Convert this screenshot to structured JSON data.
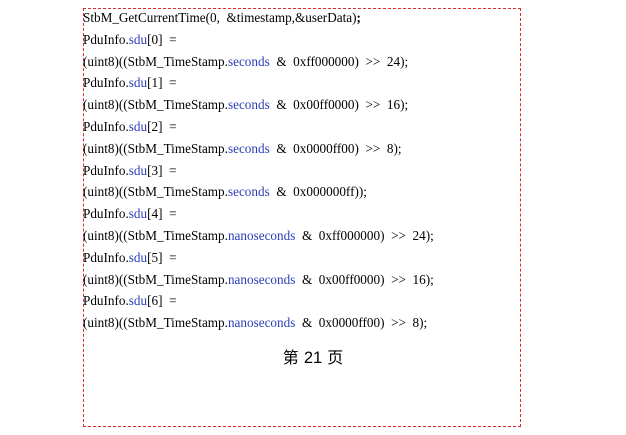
{
  "code_lines": [
    {
      "a": "StbM_GetCurrentTime(0,  &timestamp,&userData)",
      "b": ";",
      "c": ""
    },
    {
      "a": "PduInfo.",
      "b": "sdu",
      "c": "[0]  ="
    },
    {
      "a": "(uint8)((StbM_TimeStamp.",
      "b": "seconds",
      "c": "  &  0xff000000)  >>  24);"
    },
    {
      "a": "PduInfo.",
      "b": "sdu",
      "c": "[1]  ="
    },
    {
      "a": "(uint8)((StbM_TimeStamp.",
      "b": "seconds",
      "c": "  &  0x00ff0000)  >>  16);"
    },
    {
      "a": "PduInfo.",
      "b": "sdu",
      "c": "[2]  ="
    },
    {
      "a": "(uint8)((StbM_TimeStamp.",
      "b": "seconds",
      "c": "  &  0x0000ff00)  >>  8);"
    },
    {
      "a": "PduInfo.",
      "b": "sdu",
      "c": "[3]  ="
    },
    {
      "a": "(uint8)((StbM_TimeStamp.",
      "b": "seconds",
      "c": "  &  0x000000ff));"
    },
    {
      "a": "PduInfo.",
      "b": "sdu",
      "c": "[4]  ="
    },
    {
      "a": "(uint8)((StbM_TimeStamp.",
      "b": "nanoseconds",
      "c": "  &  0xff000000)  >>  24);"
    },
    {
      "a": "PduInfo.",
      "b": "sdu",
      "c": "[5]  ="
    },
    {
      "a": "(uint8)((StbM_TimeStamp.",
      "b": "nanoseconds",
      "c": "  &  0x00ff0000)  >>  16);"
    },
    {
      "a": "PduInfo.",
      "b": "sdu",
      "c": "[6]  ="
    },
    {
      "a": "(uint8)((StbM_TimeStamp.",
      "b": "nanoseconds",
      "c": "  &  0x0000ff00)  >>  8);"
    }
  ],
  "footer": {
    "prefix": "第 ",
    "page_number": "21",
    "suffix": " 页"
  },
  "colors": {
    "border": "#e0282d",
    "identifier": "#2b3db8",
    "text": "#000000"
  }
}
